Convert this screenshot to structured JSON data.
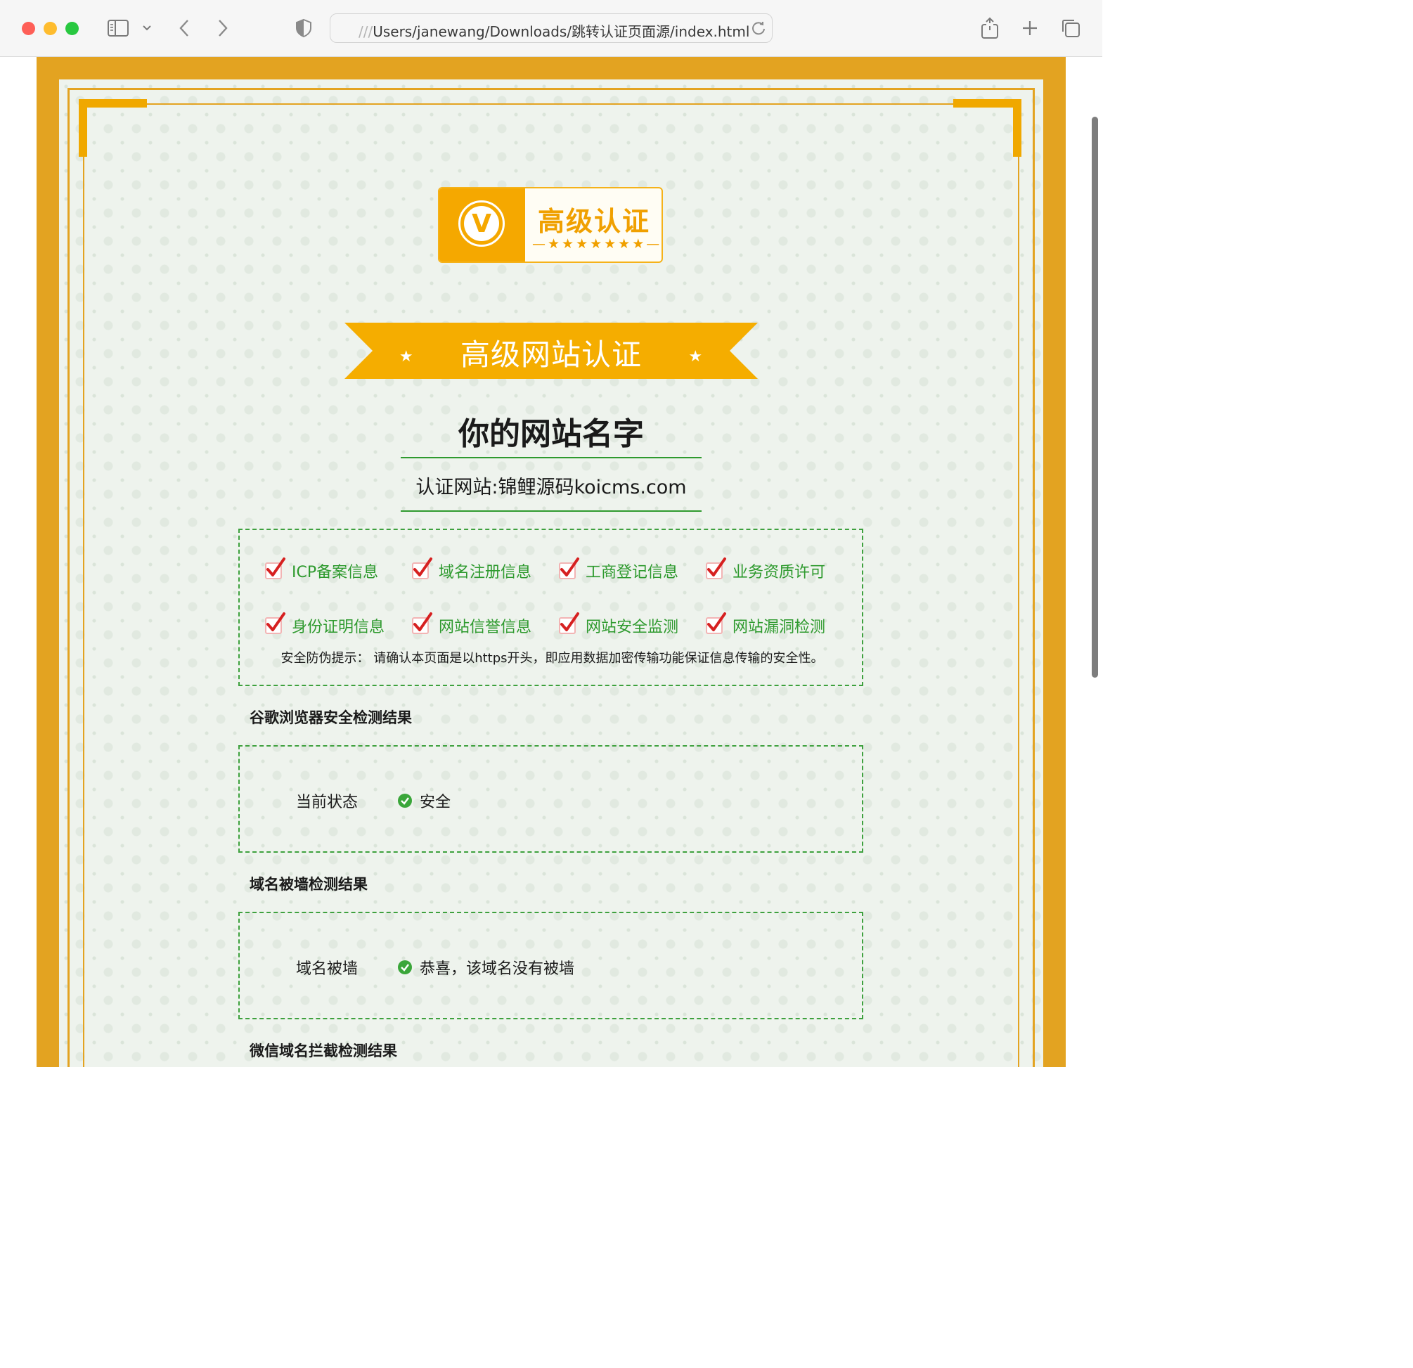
{
  "browser": {
    "url_prefix": "///",
    "url_path": "Users/janewang/Downloads/跳转认证页面源/index.html"
  },
  "logo": {
    "letter": "V",
    "title": "高级认证",
    "stars": "—★★★★★★★—"
  },
  "ribbon": {
    "title": "高级网站认证",
    "star": "★"
  },
  "site": {
    "name": "你的网站名字",
    "cert_url": "认证网站:锦鲤源码koicms.com"
  },
  "checks": {
    "row1": [
      "ICP备案信息",
      "域名注册信息",
      "工商登记信息",
      "业务资质许可"
    ],
    "row2": [
      "身份证明信息",
      "网站信誉信息",
      "网站安全监测",
      "网站漏洞检测"
    ],
    "notice": "安全防伪提示：  请确认本页面是以https开头，即应用数据加密传输功能保证信息传输的安全性。"
  },
  "google_check": {
    "title": "谷歌浏览器安全检测结果",
    "label": "当前状态",
    "value": "安全"
  },
  "block_check": {
    "title": "域名被墙检测结果",
    "label": "域名被墙",
    "value": "恭喜，该域名没有被墙"
  },
  "wechat_check": {
    "title": "微信域名拦截检测结果"
  },
  "colors": {
    "gold": "#e3a321",
    "ribbon": "#f5ad00",
    "green": "#2e9a2e",
    "check_red": "#d62020"
  }
}
